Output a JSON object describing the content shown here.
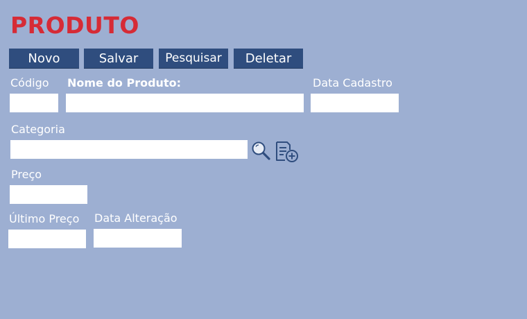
{
  "page": {
    "title": "PRODUTO"
  },
  "toolbar": {
    "novo_label": "Novo",
    "salvar_label": "Salvar",
    "pesquisar_label": "Pesquisar",
    "deletar_label": "Deletar"
  },
  "form": {
    "codigo": {
      "label": "Código",
      "value": ""
    },
    "nome_produto": {
      "label": "Nome do Produto:",
      "value": ""
    },
    "data_cadastro": {
      "label": "Data Cadastro",
      "value": ""
    },
    "categoria": {
      "label": "Categoria",
      "value": ""
    },
    "preco": {
      "label": "Preço",
      "value": ""
    },
    "ultimo_preco": {
      "label": "Último Preço",
      "value": ""
    },
    "data_alteracao": {
      "label": "Data Alteração",
      "value": ""
    }
  },
  "icons": {
    "search": "search-icon",
    "add_category": "add-document-icon"
  },
  "colors": {
    "background": "#9dafd2",
    "title": "#d62b36",
    "button": "#2f4d7e",
    "icon": "#2f4d7e"
  }
}
